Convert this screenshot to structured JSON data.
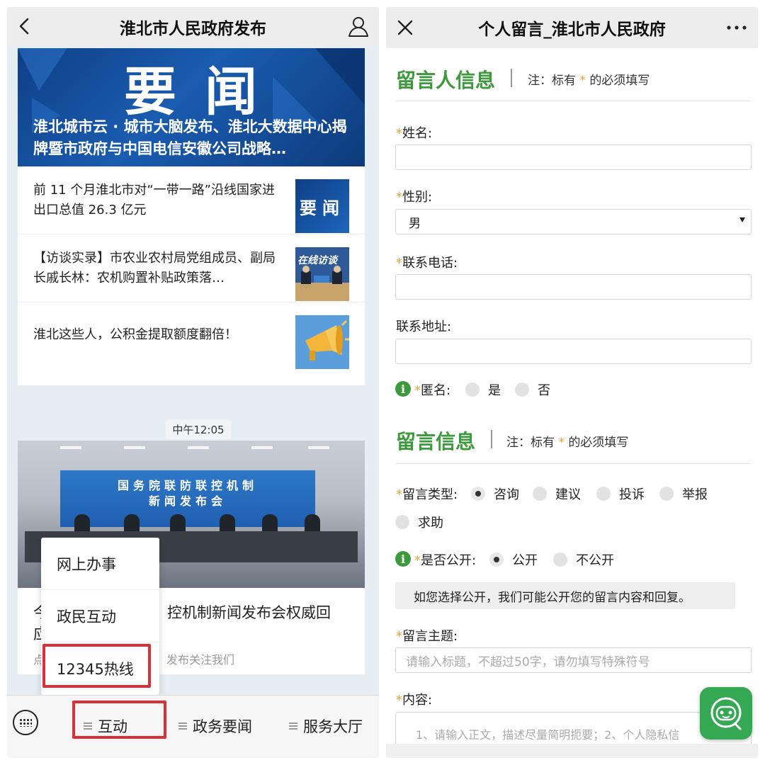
{
  "left": {
    "header_title": "淮北市人民政府发布",
    "banner": {
      "big_text": "要闻",
      "headline": "淮北城市云 · 城市大脑发布、淮北大数据中心揭牌暨市政府与中国电信安徽公司战略…"
    },
    "news": [
      {
        "title": "前 11 个月淮北市对“一带一路”沿线国家进出口总值 26.3 亿元",
        "thumb_text": "要闻",
        "thumb": "yaowen-thumbnail"
      },
      {
        "title": "【访谈实录】市农业农村局党组成员、副局长戚长林：农机购置补贴政策落…",
        "thumb_text": "在线访谈",
        "thumb": "interview-thumbnail"
      },
      {
        "title": "淮北这些人，公积金提取额度翻倍！",
        "thumb": "megaphone-thumbnail"
      }
    ],
    "time_chip": "中午12:05",
    "article": {
      "screen_line1": "国务院联防联控机制",
      "screen_line2": "新闻发布会",
      "title": "今…控机制新闻发布会权威回应…",
      "title_left": "今",
      "title_left2": "应",
      "title_right": "控机制新闻发布会权威回",
      "sub_left": "点",
      "sub_right": "发布关注我们"
    },
    "popup_menu": [
      "网上办事",
      "政民互动",
      "12345热线"
    ],
    "bottom_tabs": {
      "t1": "互动",
      "t2": "政务要闻",
      "t3": "服务大厅"
    }
  },
  "right": {
    "header_title": "个人留言_淮北市人民政府",
    "section1": {
      "title": "留言人信息",
      "note_prefix": "注：标有",
      "note_star": "*",
      "note_suffix": "的必须填写"
    },
    "fields": {
      "name_label": "姓名:",
      "gender_label": "性别:",
      "gender_value": "男",
      "phone_label": "联系电话:",
      "address_label": "联系地址:",
      "anon_label": "匿名:",
      "anon_yes": "是",
      "anon_no": "否"
    },
    "section2": {
      "title": "留言信息",
      "note_prefix": "注：标有",
      "note_star": "*",
      "note_suffix": "的必须填写"
    },
    "type": {
      "label": "留言类型:",
      "options": [
        "咨询",
        "建议",
        "投诉",
        "举报",
        "求助"
      ],
      "selected": "咨询"
    },
    "public": {
      "label": "是否公开:",
      "yes": "公开",
      "no": "不公开",
      "selected": "公开",
      "hint": "如您选择公开，我们可能公开您的留言内容和回复。"
    },
    "subject": {
      "label": "留言主题:",
      "placeholder": "请输入标题，不超过50字，请勿填写特殊符号"
    },
    "content": {
      "label": "内容:",
      "placeholder": "1、请输入正文，描述尽量简明扼要；2、个人隐私信"
    },
    "star": "*"
  },
  "colors": {
    "accent_green": "#3c9a3c",
    "highlight_red": "#d9303a",
    "banner_blue": "#0f3f86",
    "required_star": "#e8a33a"
  }
}
